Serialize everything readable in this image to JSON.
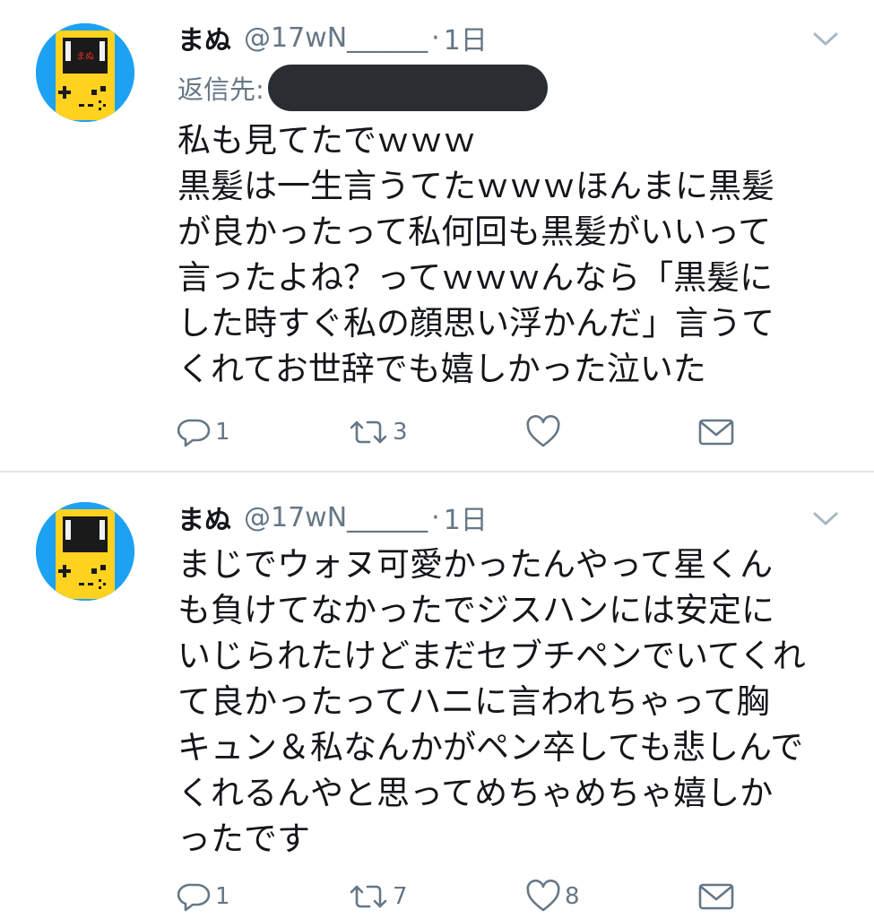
{
  "tweets": [
    {
      "name": "まぬ",
      "handle": "@17wN______",
      "dot": "·",
      "time": "1日",
      "reply_to_label": "返信先:",
      "avatar_text": "まぬ",
      "lines": [
        "私も見てたでｗｗｗ",
        "黒髪は一生言うてたｗｗｗほんまに黒髪",
        "が良かったって私何回も黒髪がいいって",
        "言ったよね？ってｗｗｗんなら「黒髪に",
        "した時すぐ私の顔思い浮かんだ」言うて",
        "くれてお世辞でも嬉しかった泣いた"
      ],
      "reply_count": "1",
      "retweet_count": "3",
      "like_count": ""
    },
    {
      "name": "まぬ",
      "handle": "@17wN______",
      "dot": "·",
      "time": "1日",
      "avatar_text": "",
      "lines": [
        "まじでウォヌ可愛かったんやって星くん",
        "も負けてなかったでジスハンには安定に",
        "いじられたけどまだセブチペンでいてくれ",
        "て良かったってハニに言われちゃって胸",
        "キュン＆私なんかがペン卒しても悲しんで",
        "くれるんやと思ってめちゃめちゃ嬉しか",
        "ったです"
      ],
      "reply_count": "1",
      "retweet_count": "7",
      "like_count": "8"
    }
  ],
  "colors": {
    "text": "#14171a",
    "secondary": "#657786",
    "avatar_bg": "#1da1f2",
    "gameboy": "#ffd21f",
    "redaction": "#2a2d31"
  },
  "icons": [
    "reply-icon",
    "retweet-icon",
    "like-icon",
    "direct-message-icon",
    "chevron-down-icon"
  ]
}
